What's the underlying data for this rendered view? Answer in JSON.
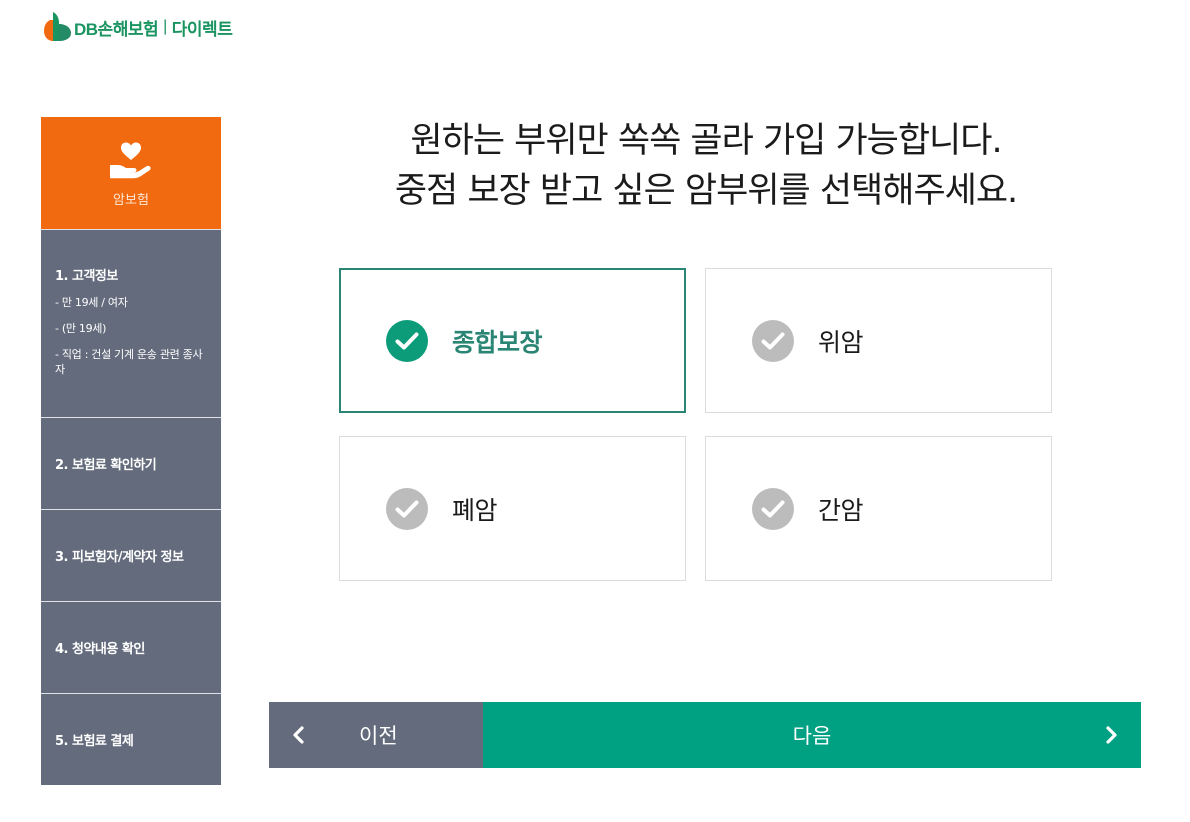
{
  "brand": {
    "name": "DB손해보험",
    "separator": "|",
    "channel": "다이렉트",
    "color": "#1a9460"
  },
  "sidebar": {
    "category": {
      "icon": "heart-hand-icon",
      "label": "암보험",
      "color": "#f26a10"
    },
    "steps": [
      {
        "title": "1. 고객정보",
        "details": [
          "- 만 19세 / 여자",
          "- (만 19세)",
          "- 직업 : 건설 기계 운송 관련 종사자"
        ]
      },
      {
        "title": "2. 보험료 확인하기"
      },
      {
        "title": "3. 피보험자/계약자 정보"
      },
      {
        "title": "4. 청약내용 확인"
      },
      {
        "title": "5. 보험료 결제"
      }
    ]
  },
  "main": {
    "headline_line1": "원하는 부위만 쏙쏙 골라 가입 가능합니다.",
    "headline_line2": "중점 보장 받고 싶은 암부위를 선택해주세요.",
    "options": [
      {
        "label": "종합보장",
        "selected": true
      },
      {
        "label": "위암",
        "selected": false
      },
      {
        "label": "폐암",
        "selected": false
      },
      {
        "label": "간암",
        "selected": false
      }
    ],
    "accent_color": "#00a083"
  },
  "nav": {
    "prev_label": "이전",
    "next_label": "다음"
  }
}
